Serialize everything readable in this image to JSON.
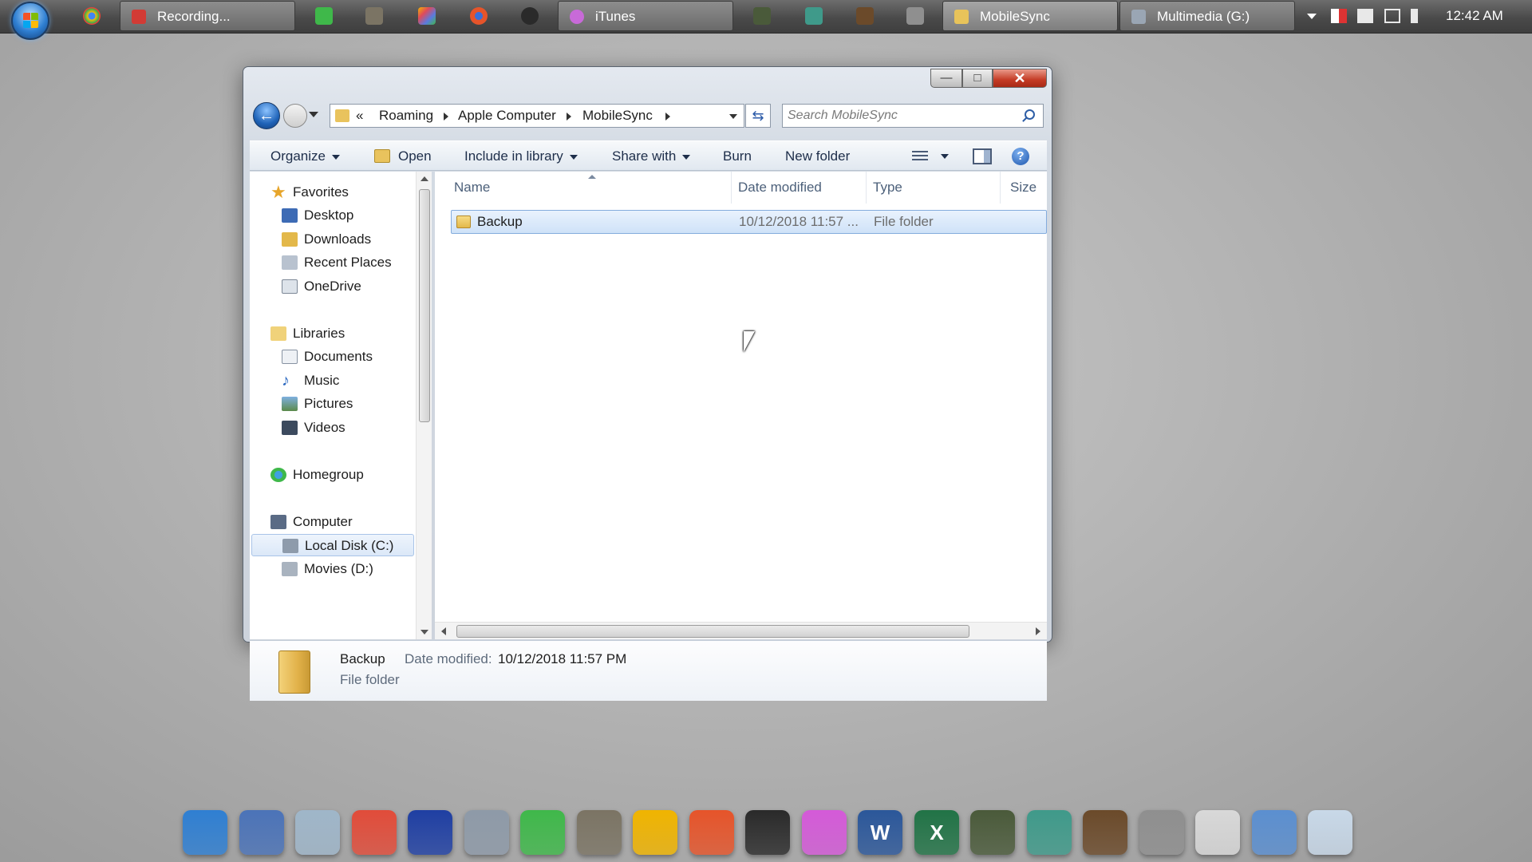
{
  "taskbar": {
    "buttons": [
      {
        "label": "Recording...",
        "color": "#d23b35"
      },
      {
        "label": "iTunes",
        "color": "#c86ad8"
      },
      {
        "label": "MobileSync",
        "color": "#e8c35a"
      },
      {
        "label": "Multimedia (G:)",
        "color": "#9aa6b4"
      }
    ],
    "quick_launch": [
      "chrome-icon",
      "camtasia-icon",
      "gimp-icon",
      "photos-icon",
      "firefox-icon",
      "inkscape-icon",
      "book-icon",
      "tablet-icon",
      "tools-icon",
      "pen-icon"
    ],
    "tray_icons": [
      "flag-icon",
      "network-icon",
      "monitor-icon",
      "volume-icon"
    ],
    "clock": "12:42 AM"
  },
  "window": {
    "address": {
      "overflow_glyph": "«",
      "segments": [
        "Roaming",
        "Apple Computer",
        "MobileSync"
      ]
    },
    "search": {
      "placeholder": "Search MobileSync"
    },
    "toolbar": {
      "organize": "Organize",
      "open": "Open",
      "include_in_library": "Include in library",
      "share_with": "Share with",
      "burn": "Burn",
      "new_folder": "New folder"
    },
    "nav": {
      "favorites": "Favorites",
      "desktop": "Desktop",
      "downloads": "Downloads",
      "recent_places": "Recent Places",
      "onedrive": "OneDrive",
      "libraries": "Libraries",
      "documents": "Documents",
      "music": "Music",
      "pictures": "Pictures",
      "videos": "Videos",
      "homegroup": "Homegroup",
      "computer": "Computer",
      "local_disk": "Local Disk (C:)",
      "movies": "Movies (D:)"
    },
    "columns": {
      "name": "Name",
      "date_modified": "Date modified",
      "type": "Type",
      "size": "Size"
    },
    "files": [
      {
        "name": "Backup",
        "date_modified": "10/12/2018 11:57 ...",
        "type": "File folder",
        "size": ""
      }
    ],
    "details": {
      "name": "Backup",
      "date_label": "Date modified:",
      "date_value": "10/12/2018 11:57 PM",
      "type": "File folder"
    }
  },
  "dock": {
    "icons": [
      {
        "name": "windows-icon",
        "color": "#2f7fd2",
        "glyph": ""
      },
      {
        "name": "computer-icon",
        "color": "#4b73b8",
        "glyph": ""
      },
      {
        "name": "recycle-bin-icon",
        "color": "#9fb6c9",
        "glyph": ""
      },
      {
        "name": "chrome-icon",
        "color": "#e14c3a",
        "glyph": ""
      },
      {
        "name": "audacity-icon",
        "color": "#1f3fa3",
        "glyph": ""
      },
      {
        "name": "tools-icon",
        "color": "#8e9aa8",
        "glyph": ""
      },
      {
        "name": "camtasia-icon",
        "color": "#3fb84a",
        "glyph": ""
      },
      {
        "name": "gimp-icon",
        "color": "#7b7464",
        "glyph": ""
      },
      {
        "name": "photos-icon",
        "color": "#f0b400",
        "glyph": ""
      },
      {
        "name": "firefox-icon",
        "color": "#e6542a",
        "glyph": ""
      },
      {
        "name": "inkscape-icon",
        "color": "#2a2a2a",
        "glyph": ""
      },
      {
        "name": "itunes-icon",
        "color": "#d45ad8",
        "glyph": ""
      },
      {
        "name": "word-icon",
        "color": "#2b579a",
        "glyph": "W"
      },
      {
        "name": "excel-icon",
        "color": "#217346",
        "glyph": "X"
      },
      {
        "name": "book-icon",
        "color": "#4a5a3a",
        "glyph": ""
      },
      {
        "name": "tablet-icon",
        "color": "#3f9a8a",
        "glyph": ""
      },
      {
        "name": "drawing-icon",
        "color": "#6b4a2a",
        "glyph": ""
      },
      {
        "name": "editor-icon",
        "color": "#8f8f8f",
        "glyph": ""
      },
      {
        "name": "notes-icon",
        "color": "#d8d8d8",
        "glyph": ""
      },
      {
        "name": "installer-icon",
        "color": "#5b8fd0",
        "glyph": ""
      },
      {
        "name": "clock-icon",
        "color": "#c8d8e8",
        "glyph": ""
      }
    ]
  }
}
